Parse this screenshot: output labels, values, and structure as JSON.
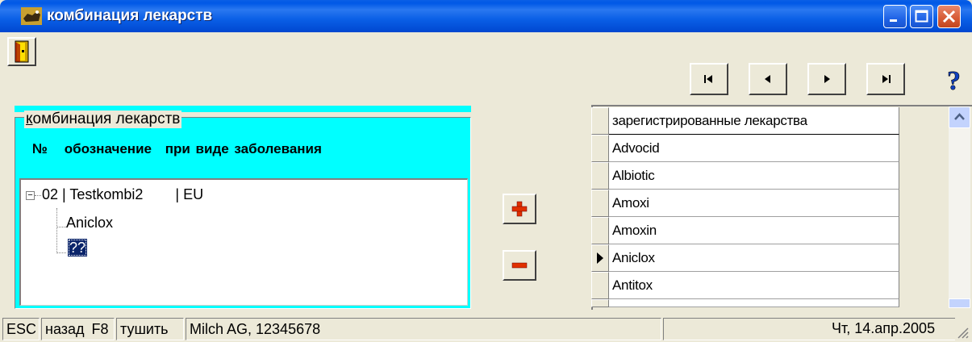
{
  "window": {
    "title": "комбинация лекарств",
    "controls": {
      "minimize": "minimize-icon",
      "maximize": "maximize-icon",
      "close": "close-icon"
    }
  },
  "toolbar": {
    "exit_icon": "door-exit-icon",
    "nav": [
      "first-record-icon",
      "prior-record-icon",
      "next-record-icon",
      "last-record-icon"
    ],
    "help_icon": "help-icon",
    "help_label": "?"
  },
  "left_panel": {
    "group_title_first": "к",
    "group_title_rest": "омбинация лекарств",
    "header": {
      "num": "№",
      "designation": "обозначение",
      "for_disease": "при виде заболевания"
    },
    "tree": {
      "root": {
        "number": "02",
        "name": "Testkombi2",
        "region": "EU",
        "label": "02 | Testkombi2        | EU"
      },
      "children": [
        "Aniclox",
        "??"
      ]
    }
  },
  "actions": {
    "add_label": "+",
    "remove_label": "−"
  },
  "grid": {
    "header": "зарегистрированные лекарства",
    "rows": [
      "Advocid",
      "Albiotic",
      "Amoxi",
      "Amoxin",
      "Aniclox",
      "Antitox"
    ],
    "current_index": 4
  },
  "statusbar": {
    "esc_key": "ESC",
    "esc_label": "назад",
    "f8_key": "F8",
    "f8_label": "тушить",
    "customer": "Milch AG, 12345678",
    "date": "Чт, 14.апр.2005"
  },
  "colors": {
    "accent": "#00FFFF",
    "selection": "#0A246A",
    "titlebar": "#0A5FE6",
    "plus": "#E03000",
    "minus": "#E03000"
  }
}
